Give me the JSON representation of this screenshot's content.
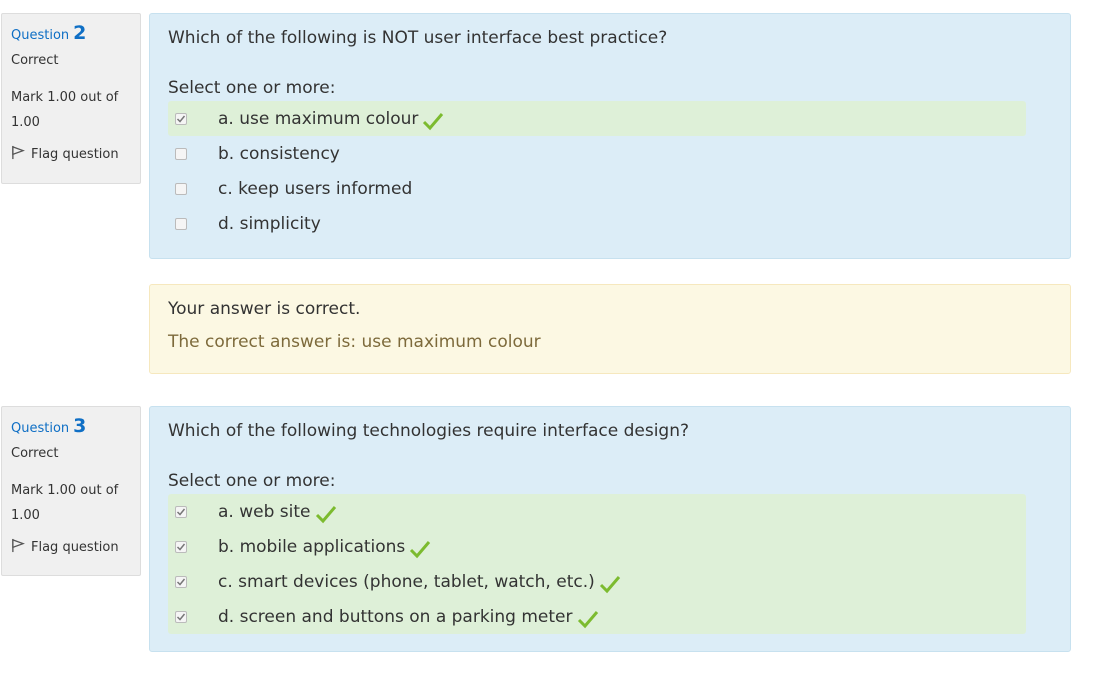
{
  "questions": [
    {
      "label": "Question",
      "number": "2",
      "state": "Correct",
      "grade": "Mark 1.00 out of 1.00",
      "flag_label": "Flag question",
      "text": "Which of the following is NOT user interface best practice?",
      "prompt": "Select one or more:",
      "answers": [
        {
          "text": "a. use maximum colour",
          "checked": true,
          "correct": true
        },
        {
          "text": "b. consistency",
          "checked": false,
          "correct": false
        },
        {
          "text": "c. keep users informed",
          "checked": false,
          "correct": false
        },
        {
          "text": "d. simplicity",
          "checked": false,
          "correct": false
        }
      ],
      "feedback": {
        "general": "Your answer is correct.",
        "right_answer": "The correct answer is: use maximum colour"
      }
    },
    {
      "label": "Question",
      "number": "3",
      "state": "Correct",
      "grade": "Mark 1.00 out of 1.00",
      "flag_label": "Flag question",
      "text": "Which of the following technologies require interface design?",
      "prompt": "Select one or more:",
      "answers": [
        {
          "text": "a. web site",
          "checked": true,
          "correct": true
        },
        {
          "text": "b. mobile applications",
          "checked": true,
          "correct": true
        },
        {
          "text": "c. smart devices (phone, tablet, watch, etc.)",
          "checked": true,
          "correct": true
        },
        {
          "text": "d. screen and buttons on a parking meter",
          "checked": true,
          "correct": true
        }
      ]
    }
  ],
  "colors": {
    "accent": "#0f6fc5",
    "question_bg": "#dcedf7",
    "correct_bg": "#def0d8",
    "feedback_bg": "#fcf8e3",
    "tick": "#7cbb2f"
  }
}
